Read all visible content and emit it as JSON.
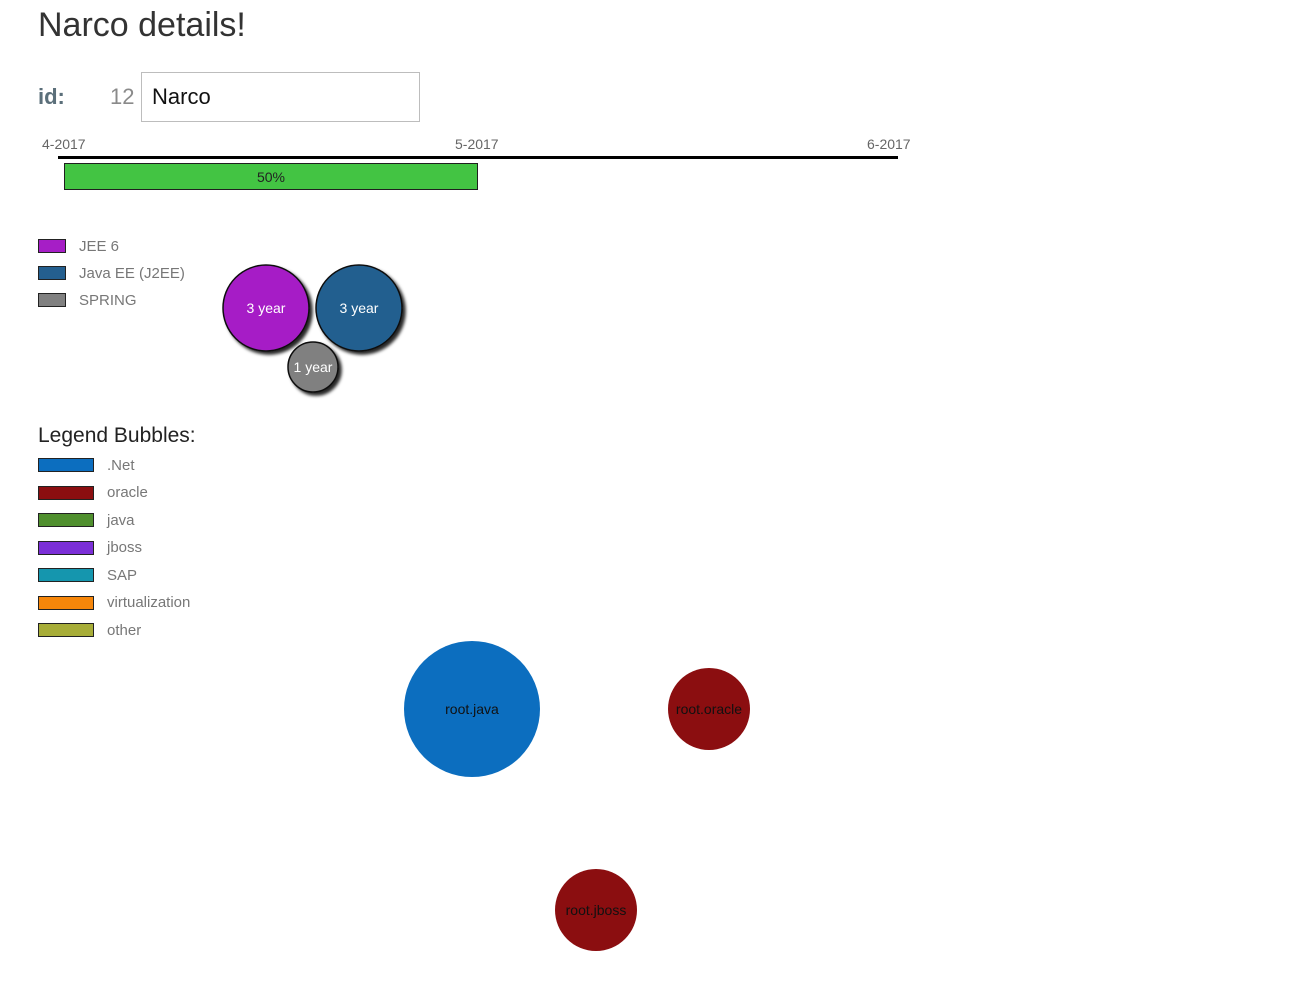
{
  "page": {
    "title": "Narco details!"
  },
  "form": {
    "id_label": "id:",
    "id_value": "12",
    "name_value": "Narco"
  },
  "timeline": {
    "ticks": [
      "4-2017",
      "5-2017",
      "6-2017"
    ],
    "progress": 0.5,
    "progress_label": "50%",
    "bar_color": "#43c443"
  },
  "skills": {
    "legend": [
      {
        "label": "JEE 6",
        "color": "#a61ec6"
      },
      {
        "label": "Java EE (J2EE)",
        "color": "#245f8f"
      },
      {
        "label": "SPRING",
        "color": "#808080"
      }
    ],
    "bubbles": [
      {
        "label": "3 year",
        "color": "#a61ec6"
      },
      {
        "label": "3 year",
        "color": "#245f8f"
      },
      {
        "label": "1 year",
        "color": "#808080"
      }
    ]
  },
  "legend_bubbles": {
    "title": "Legend Bubbles:",
    "items": [
      {
        "label": ".Net",
        "color": "#0c6ebf"
      },
      {
        "label": "oracle",
        "color": "#8b0e10"
      },
      {
        "label": "java",
        "color": "#4f8f2e"
      },
      {
        "label": "jboss",
        "color": "#7b2fd7"
      },
      {
        "label": "SAP",
        "color": "#1596ae"
      },
      {
        "label": "virtualization",
        "color": "#f6860a"
      },
      {
        "label": "other",
        "color": "#a7ad38"
      }
    ]
  },
  "tech_bubbles": [
    {
      "label": "root.java",
      "color": "#0c6ebf"
    },
    {
      "label": "root.oracle",
      "color": "#8b0e10"
    },
    {
      "label": "root.jboss",
      "color": "#8b0e10"
    }
  ]
}
